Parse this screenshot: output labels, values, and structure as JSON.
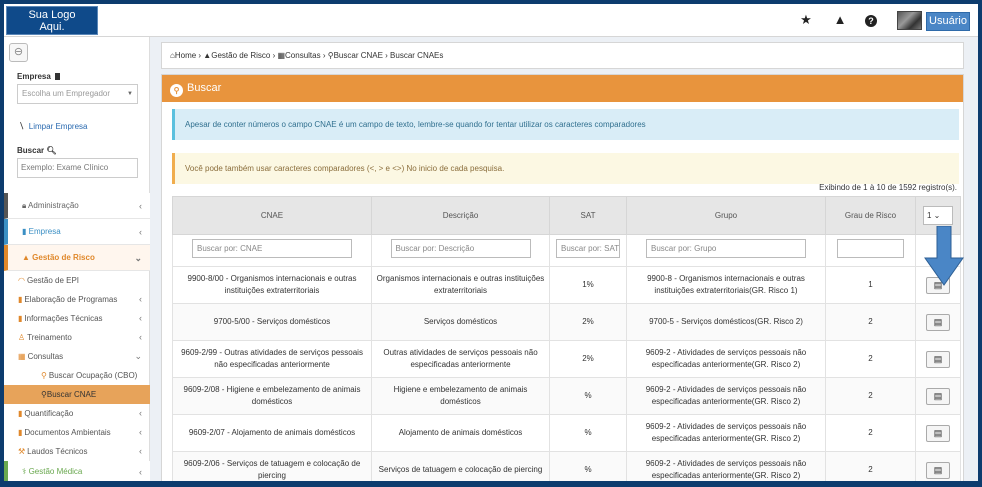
{
  "logo": {
    "line1": "Sua Logo",
    "line2": "Aqui."
  },
  "topbar": {
    "user_label": "Usuário",
    "icons": [
      "star-icon",
      "warning-icon",
      "help-icon"
    ]
  },
  "sidebar": {
    "collapse_icon": "⊖",
    "empresa_label": "Empresa",
    "empresa_placeholder": "Escolha um Empregador",
    "limpar_label": "Limpar Empresa",
    "buscar_label": "Buscar",
    "buscar_placeholder": "Exemplo: Exame Clínico",
    "menu": {
      "administracao": "Administração",
      "empresa": "Empresa",
      "gestao_risco": "Gestão de Risco",
      "gestao_epi": "Gestão de EPI",
      "elaboracao": "Elaboração de Programas",
      "informacoes": "Informações Técnicas",
      "treinamento": "Treinamento",
      "consultas": "Consultas",
      "buscar_cbo": "Buscar Ocupação (CBO)",
      "buscar_cnae": "Buscar CNAE",
      "quantificacao": "Quantificação",
      "documentos": "Documentos Ambientais",
      "laudos": "Laudos Técnicos",
      "gestao_medica": "Gestão Médica"
    }
  },
  "breadcrumb": {
    "home": "Home",
    "gestao": "Gestão de Risco",
    "consultas": "Consultas",
    "buscar": "Buscar CNAE",
    "current": "Buscar CNAEs"
  },
  "panel": {
    "title": "Buscar",
    "info": "Apesar de conter números o campo CNAE é um campo de texto, lembre-se quando for tentar utilizar os caracteres comparadores",
    "warning": "Você pode também usar caracteres comparadores (<, > e <>) No inicio de cada pesquisa.",
    "count": "Exibindo de 1 à 10 de 1592 registro(s)."
  },
  "table": {
    "headers": [
      "CNAE",
      "Descrição",
      "SAT",
      "Grupo",
      "Grau de Risco"
    ],
    "length_value": "1",
    "placeholders": [
      "Buscar por: CNAE",
      "Buscar por: Descrição",
      "Buscar por: SAT",
      "Buscar por: Grupo"
    ],
    "rows": [
      {
        "cnae": "9900-8/00 - Organismos internacionais e outras instituições extraterritoriais",
        "descricao": "Organismos internacionais e outras instituições extraterritoriais",
        "sat": "1%",
        "grupo": "9900-8 - Organismos internacionais e outras instituições extraterritoriais(GR. Risco 1)",
        "grau": "1"
      },
      {
        "cnae": "9700-5/00 - Serviços domésticos",
        "descricao": "Serviços domésticos",
        "sat": "2%",
        "grupo": "9700-5 - Serviços domésticos(GR. Risco 2)",
        "grau": "2"
      },
      {
        "cnae": "9609-2/99 - Outras atividades de serviços pessoais não especificadas anteriormente",
        "descricao": "Outras atividades de serviços pessoais não especificadas anteriormente",
        "sat": "2%",
        "grupo": "9609-2 - Atividades de serviços pessoais não especificadas anteriormente(GR. Risco 2)",
        "grau": "2"
      },
      {
        "cnae": "9609-2/08 - Higiene e embelezamento de animais domésticos",
        "descricao": "Higiene e embelezamento de animais domésticos",
        "sat": "%",
        "grupo": "9609-2 - Atividades de serviços pessoais não especificadas anteriormente(GR. Risco 2)",
        "grau": "2"
      },
      {
        "cnae": "9609-2/07 - Alojamento de animais domésticos",
        "descricao": "Alojamento de animais domésticos",
        "sat": "%",
        "grupo": "9609-2 - Atividades de serviços pessoais não especificadas anteriormente(GR. Risco 2)",
        "grau": "2"
      },
      {
        "cnae": "9609-2/06 - Serviços de tatuagem e colocação de piercing",
        "descricao": "Serviços de tatuagem e colocação de piercing",
        "sat": "%",
        "grupo": "9609-2 - Atividades de serviços pessoais não especificadas anteriormente(GR. Risco 2)",
        "grau": "2"
      }
    ]
  },
  "colors": {
    "accent": "#e8943d",
    "brand": "#0f4a8a",
    "info": "#d9edf7",
    "warning": "#fcf8e3",
    "arrow": "#4a86c6"
  }
}
